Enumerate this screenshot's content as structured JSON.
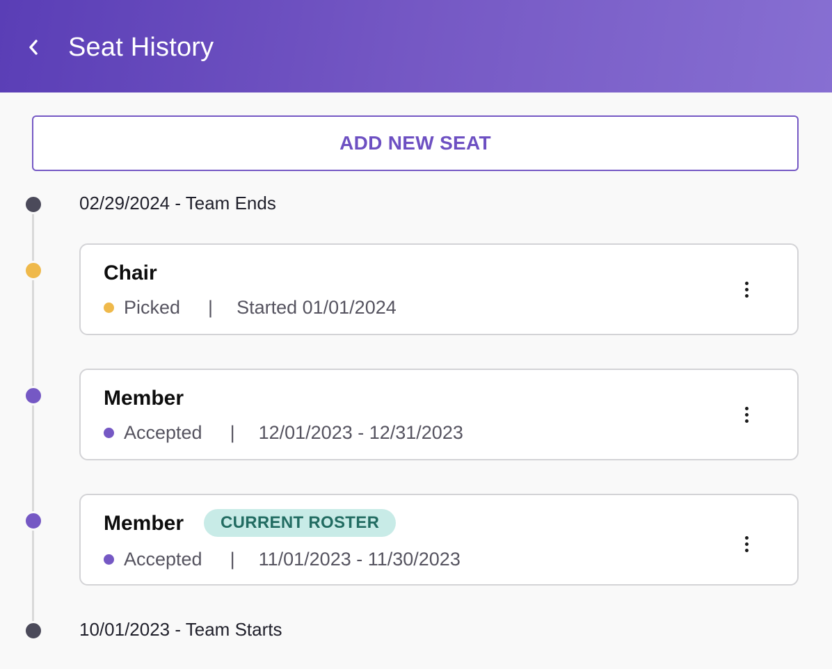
{
  "header": {
    "title": "Seat History",
    "back_icon": "chevron-left-icon"
  },
  "actions": {
    "add_seat_label": "ADD NEW SEAT"
  },
  "timeline": {
    "end_label": "02/29/2024 - Team Ends",
    "start_label": "10/01/2023 - Team Starts"
  },
  "seats": [
    {
      "role": "Chair",
      "status": "Picked",
      "separator": "|",
      "dates": "Started 01/01/2024",
      "badge": "",
      "status_color": "#efb94b",
      "menu_icon": "more-vert-icon"
    },
    {
      "role": "Member",
      "status": "Accepted",
      "separator": "|",
      "dates": "12/01/2023 - 12/31/2023",
      "badge": "",
      "status_color": "#7558c4",
      "menu_icon": "more-vert-icon"
    },
    {
      "role": "Member",
      "status": "Accepted",
      "separator": "|",
      "dates": "11/01/2023 - 11/30/2023",
      "badge": "CURRENT ROSTER",
      "status_color": "#7558c4",
      "menu_icon": "more-vert-icon"
    }
  ],
  "colors": {
    "brand_purple": "#7558c4",
    "picked_gold": "#efb94b",
    "badge_bg": "#c8ebe7",
    "badge_text": "#226c62"
  }
}
